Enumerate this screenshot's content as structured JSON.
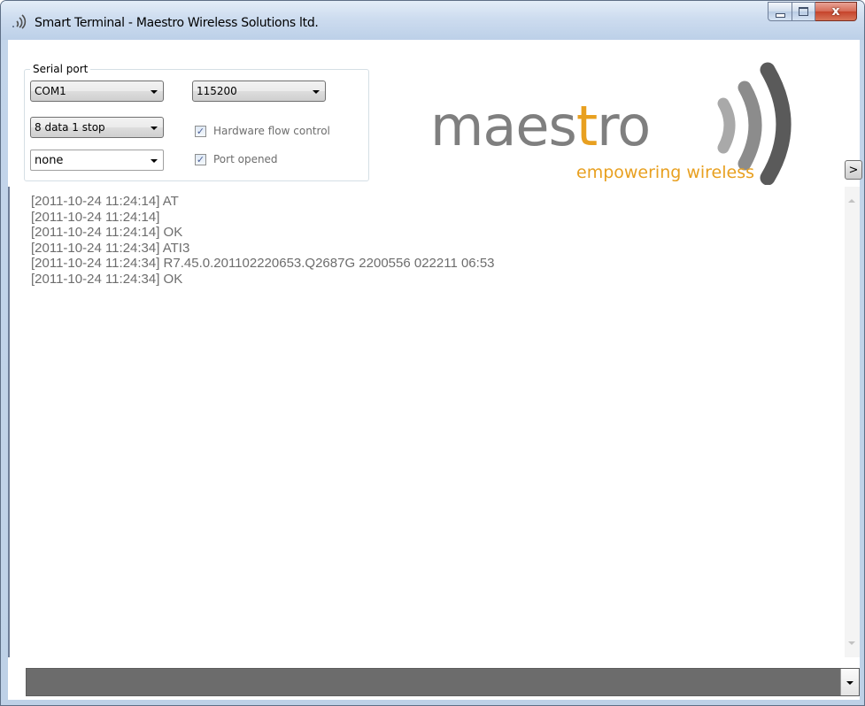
{
  "window": {
    "title": "Smart Terminal - Maestro Wireless Solutions ltd.",
    "app_icon": "signal-waves-icon",
    "controls": {
      "minimize": "minimize-icon",
      "maximize": "maximize-icon",
      "close": "x",
      "close_icon": "close-icon"
    }
  },
  "serial_port": {
    "legend": "Serial port",
    "port": "COM1",
    "baud_rate": "115200",
    "framing": "8 data 1 stop",
    "parity": "none",
    "hardware_flow_control": {
      "label": "Hardware flow control",
      "checked": true
    },
    "port_opened": {
      "label": "Port opened",
      "checked": true
    }
  },
  "logo": {
    "wordmark": "maestro",
    "tagline": "empowering wireless",
    "colors": {
      "text": "#7f7f7f",
      "accent": "#e8a020",
      "waves": "#555555"
    }
  },
  "expand_button": {
    "label": ">"
  },
  "log": {
    "lines": [
      "[2011-10-24 11:24:14] AT",
      "[2011-10-24 11:24:14]",
      "[2011-10-24 11:24:14] OK",
      "[2011-10-24 11:24:34] ATI3",
      "[2011-10-24 11:24:34] R7.45.0.201102220653.Q2687G 2200556 022211 06:53",
      "[2011-10-24 11:24:34] OK"
    ]
  },
  "command_input": {
    "value": ""
  }
}
